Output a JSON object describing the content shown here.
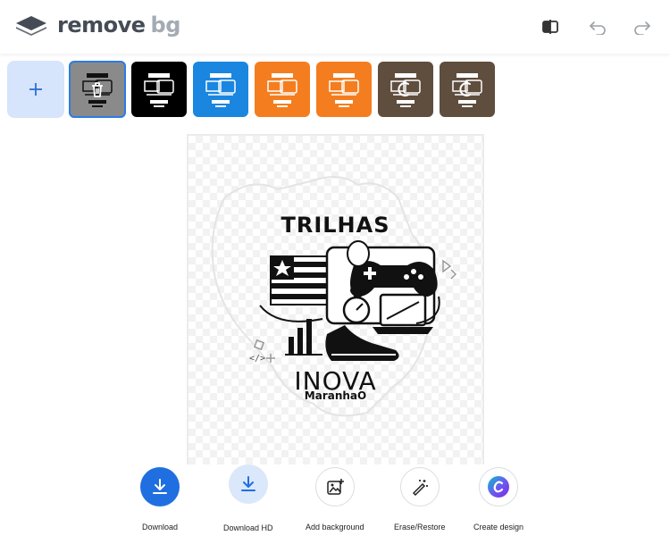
{
  "header": {
    "logo_remove": "remove",
    "logo_bg": "bg",
    "icons": [
      "compare-icon",
      "undo-icon",
      "redo-icon"
    ]
  },
  "thumbnails": [
    {
      "bg": "#8a8a8a",
      "selected": true,
      "overlay": "trash-icon"
    },
    {
      "bg": "#000000",
      "selected": false,
      "overlay": ""
    },
    {
      "bg": "#1a86e0",
      "selected": false,
      "overlay": ""
    },
    {
      "bg": "#f47e1f",
      "selected": false,
      "overlay": ""
    },
    {
      "bg": "#f47e1f",
      "selected": false,
      "overlay": ""
    },
    {
      "bg": "#5f4d3e",
      "selected": false,
      "overlay": "loading-spinner-icon"
    },
    {
      "bg": "#5f4d3e",
      "selected": false,
      "overlay": "loading-spinner-icon"
    }
  ],
  "artwork": {
    "title": "TRILHAS",
    "brand": "INOVA",
    "subtitle": "MaranhaO"
  },
  "actions": [
    {
      "label": "Download",
      "icon": "download-icon",
      "style": "primary"
    },
    {
      "label": "Download HD",
      "icon": "download-icon",
      "style": "soft"
    },
    {
      "label": "Add background",
      "icon": "image-plus-icon",
      "style": "outline"
    },
    {
      "label": "Erase/Restore",
      "icon": "magic-wand-icon",
      "style": "outline"
    },
    {
      "label": "Create design",
      "icon": "canva-icon",
      "style": "outline"
    }
  ],
  "colors": {
    "accent": "#1f6fe0",
    "accent_soft": "#dbe7fb"
  }
}
